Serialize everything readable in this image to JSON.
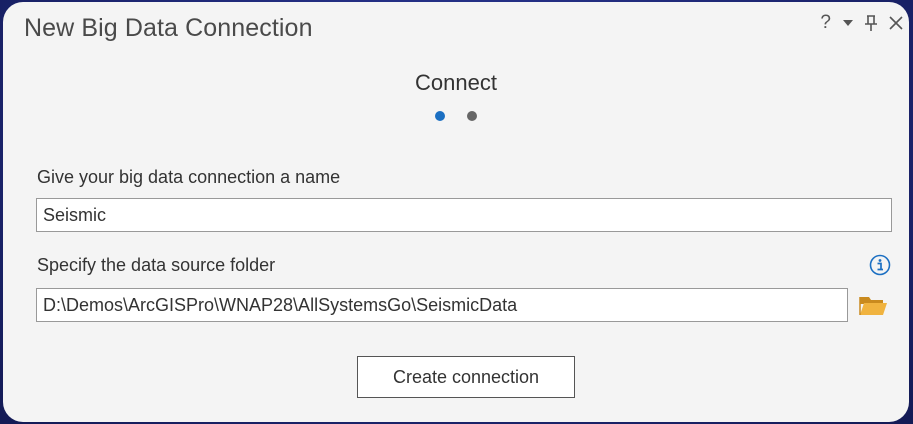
{
  "window": {
    "title": "New Big Data Connection",
    "controls": {
      "help": "?"
    }
  },
  "step": {
    "title": "Connect",
    "current": 1,
    "total": 2
  },
  "form": {
    "name_label": "Give your big data connection a name",
    "name_value": "Seismic",
    "folder_label": "Specify the data source folder",
    "folder_value": "D:\\Demos\\ArcGISPro\\WNAP28\\AllSystemsGo\\SeismicData"
  },
  "actions": {
    "create_label": "Create connection"
  },
  "icons": {
    "info": "info-icon",
    "folder": "folder-open-icon"
  },
  "colors": {
    "accent": "#1b6fc2",
    "folder": "#e8a93a",
    "background": "#1e2a78"
  }
}
